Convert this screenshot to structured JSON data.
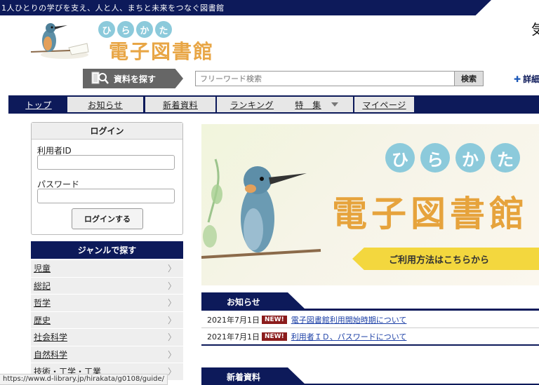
{
  "topbar": {
    "tagline": "1人ひとりの学びを支え、人と人、まちと未来をつなぐ図書館"
  },
  "header": {
    "logo_kana": [
      "ひ",
      "ら",
      "か",
      "た"
    ],
    "logo_title": "電子図書館",
    "corner_char": "気"
  },
  "search": {
    "label": "資料を探す",
    "placeholder": "フリーワード検索",
    "button": "検索",
    "detail_link": "詳細"
  },
  "nav": {
    "items": [
      "トップ",
      "お知らせ",
      "新着資料",
      "ランキング",
      "特　集",
      "マイページ"
    ]
  },
  "login": {
    "title": "ログイン",
    "user_id_label": "利用者ID",
    "password_label": "パスワード",
    "button": "ログインする"
  },
  "genre": {
    "title": "ジャンルで探す",
    "items": [
      "児童",
      "総記",
      "哲学",
      "歴史",
      "社会科学",
      "自然科学",
      "技術・工学・工業"
    ]
  },
  "hero": {
    "kana": [
      "ひ",
      "ら",
      "か",
      "た"
    ],
    "title": "電子図書館",
    "banner": "ご利用方法はこちらから"
  },
  "news": {
    "title": "お知らせ",
    "badge": "NEW!",
    "items": [
      {
        "date": "2021年7月1日",
        "text": "電子図書館利用開始時期について"
      },
      {
        "date": "2021年7月1日",
        "text": "利用者ＩＤ、パスワードについて"
      }
    ]
  },
  "new_items": {
    "title": "新着資料"
  },
  "status": {
    "url": "https://www.d-library.jp/hirakata/g0108/guide/"
  },
  "colors": {
    "navy": "#0d1a5a",
    "accent_orange": "#e8a646",
    "kana_blue": "#8ccadb",
    "badge_red": "#8b1c1c"
  }
}
